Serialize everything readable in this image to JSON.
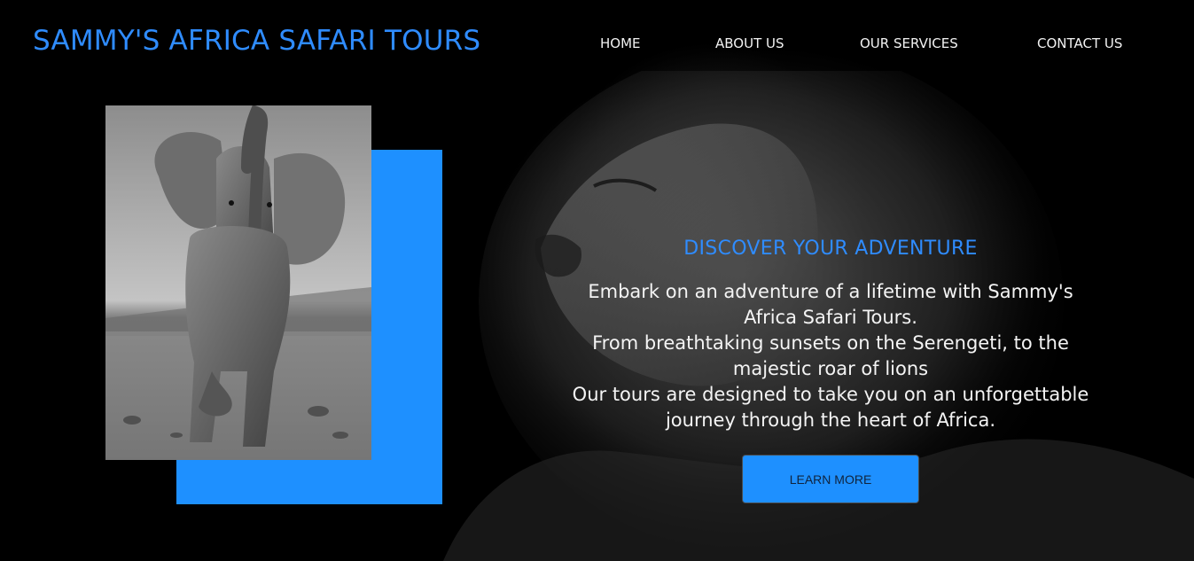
{
  "header": {
    "brand": "SAMMY'S AFRICA SAFARI TOURS",
    "nav": {
      "home": "HOME",
      "about": "ABOUT US",
      "services": "OUR SERVICES",
      "contact": "CONTACT US"
    }
  },
  "hero": {
    "heading": "DISCOVER YOUR ADVENTURE",
    "lines": [
      "Embark on an adventure of a lifetime with Sammy's",
      "Africa Safari Tours.",
      "From breathtaking sunsets on the Serengeti, to the",
      "majestic roar of lions",
      "Our tours are designed to take you on an unforgettable",
      "journey through the heart of Africa."
    ],
    "button_label": "LEARN MORE"
  },
  "images": {
    "feature_photo": "baby-elephant-photo",
    "background_photo": "lion-background-photo"
  },
  "colors": {
    "accent": "#1e90ff",
    "brand_text": "#2f8cff",
    "background": "#000000",
    "text": "#f4f4f4"
  }
}
